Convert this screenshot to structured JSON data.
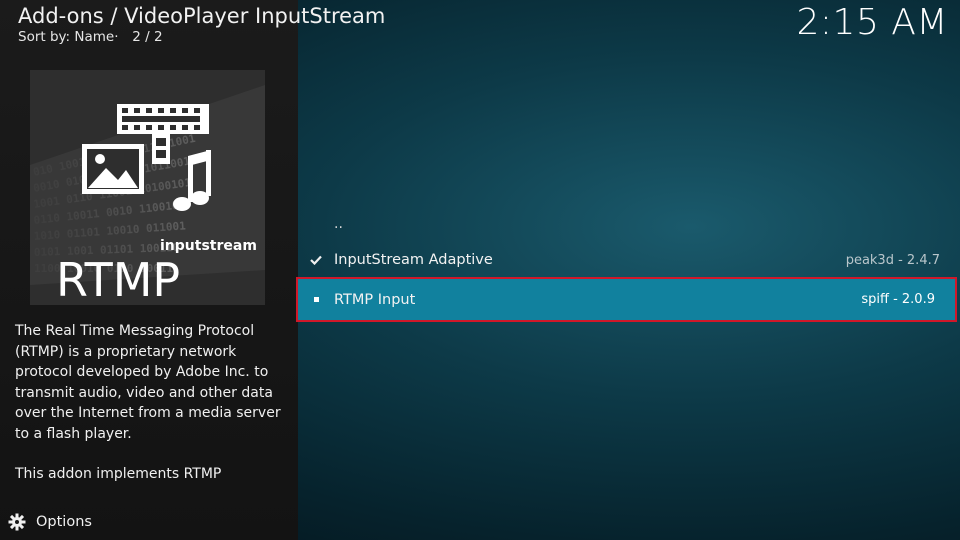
{
  "header": {
    "title": "Add-ons / VideoPlayer InputStream",
    "sort_label": "Sort by: Name",
    "page_count": "2 / 2",
    "clock": "2:15 AM"
  },
  "thumbnail": {
    "caption": "inputstream",
    "name": "RTMP",
    "icon": "film-image-music-icon"
  },
  "description": {
    "paragraph1": "The Real Time Messaging Protocol (RTMP) is a proprietary network protocol developed by Adobe Inc. to transmit audio, video and other data over the Internet from a media server to a flash player.",
    "paragraph2": "This addon implements RTMP"
  },
  "options": {
    "label": "Options",
    "icon": "gear-icon"
  },
  "list": {
    "parent_label": "..",
    "items": [
      {
        "label": "InputStream Adaptive",
        "meta": "peak3d - 2.4.7",
        "status": "enabled",
        "icon": "checkmark-icon"
      },
      {
        "label": "RTMP Input",
        "meta": "spiff - 2.0.9",
        "status": "selected",
        "icon": "bullet-icon"
      }
    ]
  },
  "colors": {
    "selected_background": "#11819e",
    "selected_outline": "#d0182a",
    "left_panel": "#181818"
  }
}
